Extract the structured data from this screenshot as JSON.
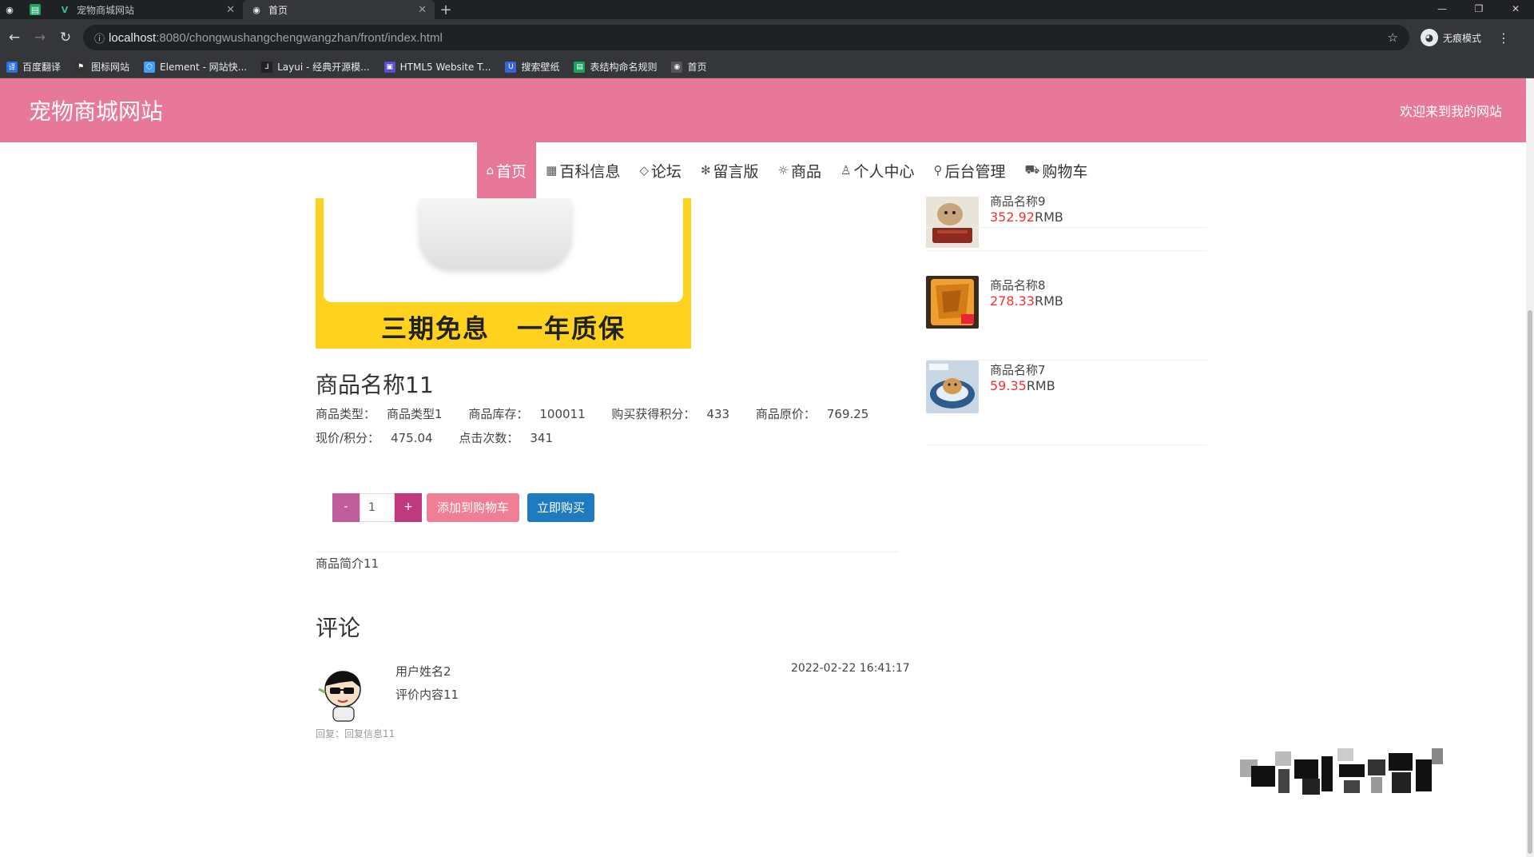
{
  "browser": {
    "tabs": [
      {
        "title": "宠物商城网站",
        "active": false
      },
      {
        "title": "首页",
        "active": true
      }
    ],
    "url_host": "localhost",
    "url_path": ":8080/chongwushangchengwangzhan/front/index.html",
    "profile_label": "无痕模式",
    "bookmarks": [
      {
        "label": "百度翻译",
        "color": "#2b6de5"
      },
      {
        "label": "图标网站",
        "color": "#333333"
      },
      {
        "label": "Element - 网站快...",
        "color": "#409eff"
      },
      {
        "label": "Layui - 经典开源模...",
        "color": "#222222"
      },
      {
        "label": "HTML5 Website T...",
        "color": "#5b4fcf"
      },
      {
        "label": "搜索壁纸",
        "color": "#3a63d8"
      },
      {
        "label": "表结构命名规则",
        "color": "#1aa260"
      },
      {
        "label": "首页",
        "color": "#555555"
      }
    ]
  },
  "header": {
    "site_title": "宠物商城网站",
    "welcome": "欢迎来到我的网站",
    "brand_color": "#e8789a"
  },
  "nav": [
    {
      "label": "首页",
      "icon": "home-icon",
      "glyph": "⌂",
      "active": true
    },
    {
      "label": "百科信息",
      "icon": "grid-icon",
      "glyph": "▦",
      "active": false
    },
    {
      "label": "论坛",
      "icon": "tag-icon",
      "glyph": "◇",
      "active": false
    },
    {
      "label": "留言版",
      "icon": "asterisk-icon",
      "glyph": "✻",
      "active": false
    },
    {
      "label": "商品",
      "icon": "sun-icon",
      "glyph": "☼",
      "active": false
    },
    {
      "label": "个人中心",
      "icon": "user-icon",
      "glyph": "♙",
      "active": false
    },
    {
      "label": "后台管理",
      "icon": "link-icon",
      "glyph": "⚲",
      "active": false
    },
    {
      "label": "购物车",
      "icon": "cart-icon",
      "glyph": "⛟",
      "active": false
    }
  ],
  "product": {
    "image_slogan": "三期免息　一年质保",
    "name": "商品名称11",
    "type_label": "商品类型：",
    "type_value": "商品类型1",
    "stock_label": "商品库存：",
    "stock_value": "100011",
    "points_label": "购买获得积分：",
    "points_value": "433",
    "orig_price_label": "商品原价：",
    "orig_price_value": "769.25",
    "cur_price_label": "现价/积分：",
    "cur_price_value": "475.04",
    "clicks_label": "点击次数：",
    "clicks_value": "341",
    "qty_minus": "-",
    "qty_value": "1",
    "qty_plus": "+",
    "add_cart_label": "添加到购物车",
    "buy_now_label": "立即购买",
    "intro": "商品简介11"
  },
  "comments": {
    "title": "评论",
    "items": [
      {
        "user": "用户姓名2",
        "content": "评价内容11",
        "time": "2022-02-22 16:41:17",
        "reply": "回复：回复信息11"
      }
    ]
  },
  "sidebar": {
    "currency": "RMB",
    "items": [
      {
        "name": "商品名称9",
        "price": "352.92"
      },
      {
        "name": "商品名称8",
        "price": "278.33"
      },
      {
        "name": "商品名称7",
        "price": "59.35"
      }
    ]
  }
}
